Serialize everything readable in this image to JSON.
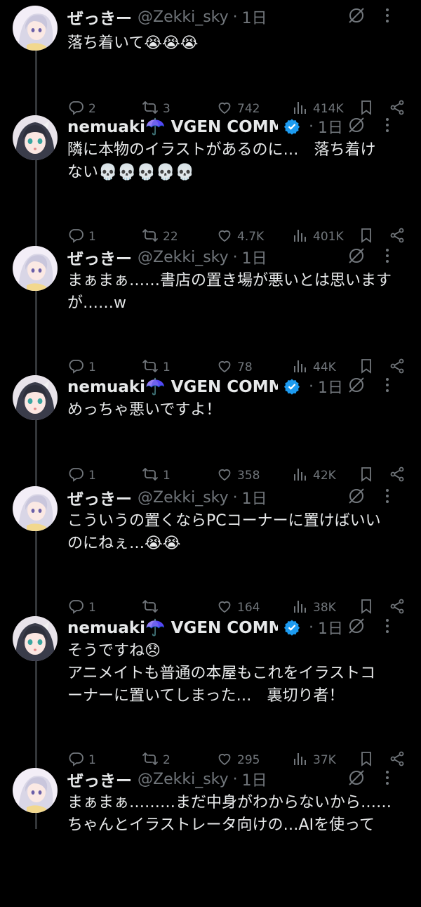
{
  "tweets": [
    {
      "name": "ぜっきー",
      "handle": "@Zekki_sky",
      "time": "1日",
      "verified": false,
      "avatar": "zekki",
      "text": "落ち着いて😭😭😭",
      "replies": "2",
      "retweets": "3",
      "likes": "742",
      "views": "414K"
    },
    {
      "name": "nemuaki☂️ VGEN COMM...",
      "handle": "",
      "time": "1日",
      "verified": true,
      "avatar": "nemuaki",
      "text": "隣に本物のイラストがあるのに…　落ち着け\nない💀💀💀💀💀",
      "replies": "1",
      "retweets": "22",
      "likes": "4.7K",
      "views": "401K"
    },
    {
      "name": "ぜっきー",
      "handle": "@Zekki_sky",
      "time": "1日",
      "verified": false,
      "avatar": "zekki",
      "text": "まぁまぁ……書店の置き場が悪いとは思います\nが……w",
      "replies": "1",
      "retweets": "1",
      "likes": "78",
      "views": "44K"
    },
    {
      "name": "nemuaki☂️ VGEN COMM...",
      "handle": "",
      "time": "1日",
      "verified": true,
      "avatar": "nemuaki",
      "text": "めっちゃ悪いですよ！",
      "replies": "1",
      "retweets": "1",
      "likes": "358",
      "views": "42K"
    },
    {
      "name": "ぜっきー",
      "handle": "@Zekki_sky",
      "time": "1日",
      "verified": false,
      "avatar": "zekki",
      "text": "こういうの置くならPCコーナーに置けばいい\nのにねぇ…😭😭",
      "replies": "1",
      "retweets": "",
      "likes": "164",
      "views": "38K"
    },
    {
      "name": "nemuaki☂️ VGEN COMM...",
      "handle": "",
      "time": "1日",
      "verified": true,
      "avatar": "nemuaki",
      "text": "そうですね😞\nアニメイトも普通の本屋もこれをイラストコ\nーナーに置いてしまった…　裏切り者！",
      "replies": "1",
      "retweets": "2",
      "likes": "295",
      "views": "37K"
    },
    {
      "name": "ぜっきー",
      "handle": "@Zekki_sky",
      "time": "1日",
      "verified": false,
      "avatar": "zekki",
      "text": "まぁまぁ………まだ中身がわからないから……\nちゃんとイラストレータ向けの…AIを使って",
      "replies": "",
      "retweets": "",
      "likes": "",
      "views": ""
    }
  ],
  "colors": {
    "background": "#000000",
    "text": "#e7e9ea",
    "muted": "#71767b",
    "verified": "#1d9bf0",
    "thread_line": "#333639"
  },
  "icons": {
    "reply": "reply-icon",
    "retweet": "retweet-icon",
    "like": "heart-icon",
    "views": "views-icon",
    "bookmark": "bookmark-icon",
    "share": "share-icon",
    "grok": "grok-icon",
    "more": "more-icon"
  }
}
